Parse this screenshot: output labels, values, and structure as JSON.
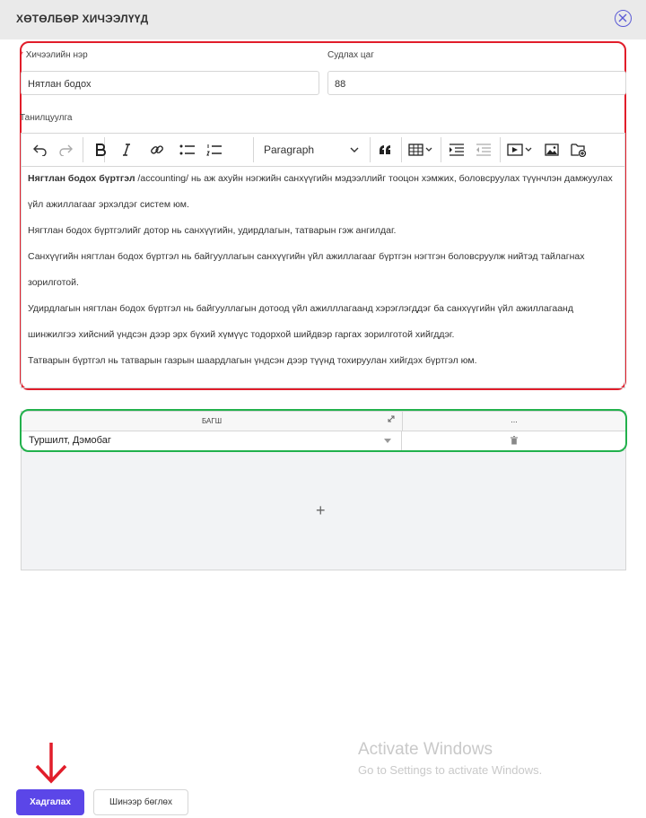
{
  "header": {
    "title": "ХӨТӨЛБӨР ХИЧЭЭЛҮҮД"
  },
  "form": {
    "name_label": "Хичээлийн нэр",
    "name_required_mark": "*",
    "name_value": "Нятлан бодох",
    "hours_label": "Судлах цаг",
    "hours_value": "88",
    "intro_label": "Танилцуулга"
  },
  "editor": {
    "toolbar": {
      "icons": [
        "undo-icon",
        "redo-icon",
        "bold-icon",
        "italic-icon",
        "link-icon",
        "bulleted-list-icon",
        "numbered-list-icon",
        "heading-dropdown",
        "blockquote-icon",
        "insert-table-icon",
        "indent-icon",
        "outdent-icon",
        "media-embed-icon",
        "image-icon",
        "file-manager-icon"
      ],
      "heading_value": "Paragraph"
    },
    "paragraphs": [
      {
        "bold": "Нягтлан бодох бүртгэл",
        "text": " /accounting/ нь аж ахуйн нэгжийн санхүүгийн мэдээллийг тооцон хэмжих, боловсруулах түүнчлэн дамжуулах үйл ажиллагааг эрхэлдэг систем юм."
      },
      {
        "bold": "",
        "text": "Нягтлан бодох бүртгэлийг дотор нь санхүүгийн, удирдлагын, татварын гэж ангилдаг."
      },
      {
        "bold": "",
        "text": "Санхүүгийн нягтлан бодох бүртгэл нь байгууллагын санхүүгийн үйл ажиллагааг бүртгэн нэгтгэн боловсруулж нийтэд тайлагнах зорилготой."
      },
      {
        "bold": "",
        "text": "Удирдлагын нягтлан бодох бүртгэл нь байгууллагын дотоод үйл ажилллагаанд хэрэглэгддэг ба санхүүгийн үйл ажиллагаанд шинжилгээ хийсний үндсэн дээр эрх бүхий хүмүүс тодорхой шийдвэр гаргах зорилготой хийгддэг."
      },
      {
        "bold": "",
        "text": "Татварын бүртгэл нь татварын газрын шаардлагын үндсэн дээр түүнд тохируулан хийгдэх бүртгэл юм."
      }
    ]
  },
  "teacher_grid": {
    "columns": [
      "БАГШ",
      "..."
    ],
    "rows": [
      {
        "teacher": "Туршилт, Дэмобаг"
      }
    ],
    "add_symbol": "+"
  },
  "watermark": {
    "line1": "Activate Windows",
    "line2": "Go to Settings to activate Windows."
  },
  "footer": {
    "save_label": "Хадгалах",
    "check_label": "Шинээр бөглөх"
  },
  "colors": {
    "accent": "#5b46e8",
    "highlight_red": "#e11d2a",
    "highlight_green": "#22b14c"
  }
}
